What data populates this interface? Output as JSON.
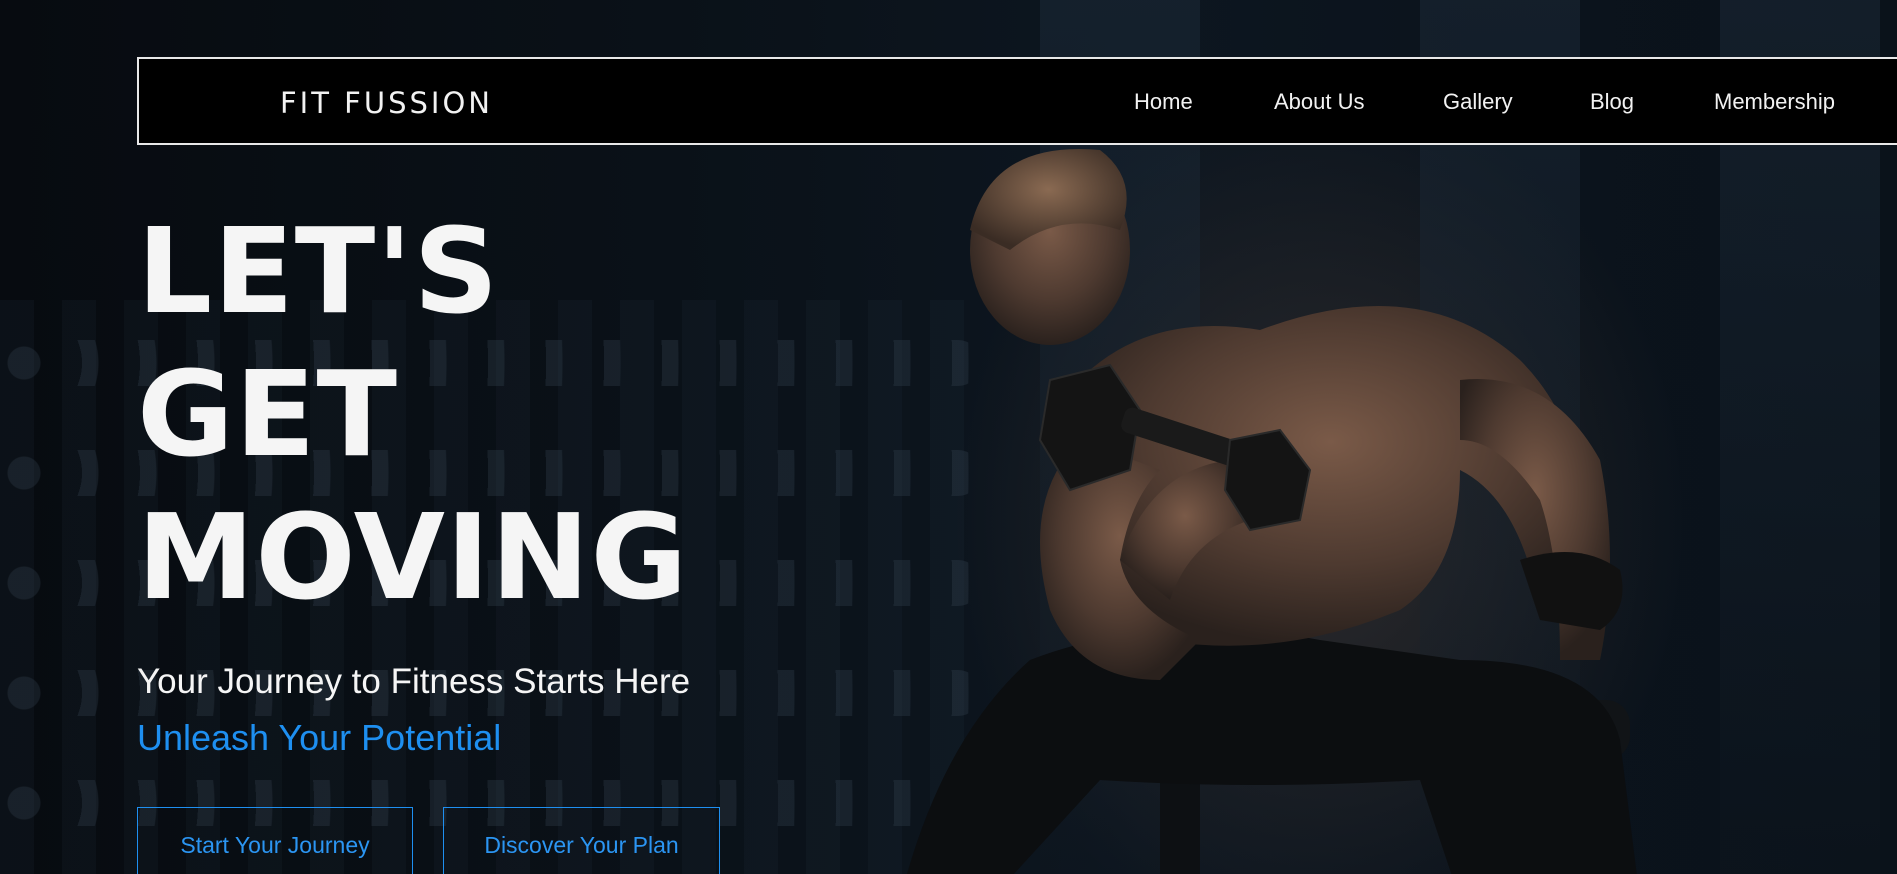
{
  "brand": {
    "name": "FIT FUSSION"
  },
  "nav": {
    "items": [
      {
        "label": "Home"
      },
      {
        "label": "About Us"
      },
      {
        "label": "Gallery"
      },
      {
        "label": "Blog"
      },
      {
        "label": "Membership"
      }
    ]
  },
  "hero": {
    "headline_lines": [
      "LET'S",
      "GET",
      "MOVING"
    ],
    "subtitle": "Your Journey to Fitness Starts Here",
    "tagline": "Unleash Your Potential",
    "buttons": [
      {
        "label": "Start Your Journey"
      },
      {
        "label": "Discover Your Plan"
      }
    ],
    "background_image": "man-lifting-dumbbell-in-dark-gym"
  },
  "colors": {
    "accent": "#1e8ff0",
    "text": "#f5f5f5",
    "nav_bg": "#000000",
    "nav_border": "#e8e8e8"
  }
}
